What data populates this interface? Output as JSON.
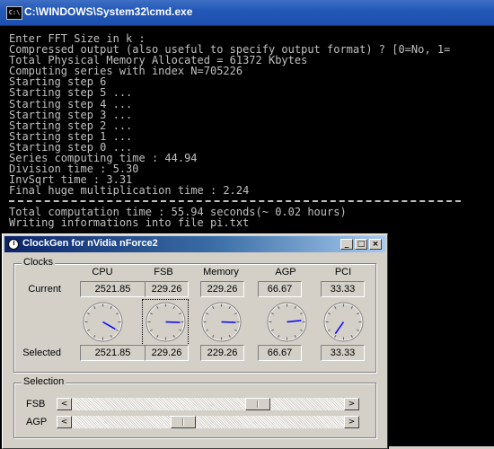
{
  "cmd": {
    "title": "C:\\WINDOWS\\System32\\cmd.exe",
    "icon": "cmd-icon",
    "lines": [
      "Enter FFT Size in k :",
      "Compressed output (also useful to specify output format) ? [0=No, 1=",
      "Total Physical Memory Allocated = 61372 Kbytes",
      "Computing series with index N=705226",
      "Starting step 6",
      "Starting step 5 ...",
      "Starting step 4 ...",
      "Starting step 3 ...",
      "Starting step 2 ...",
      "Starting step 1 ...",
      "Starting step 0 ...",
      "Series computing time : 44.94",
      "Division time : 5.30",
      "InvSqrt time : 3.31",
      "Final huge multiplication time : 2.24"
    ],
    "lines_after": [
      "Total computation time : 55.94 seconds(~ 0.02 hours)",
      "Writing informations into file pi.txt"
    ]
  },
  "clockgen": {
    "title": "ClockGen for nVidia nForce2",
    "title_buttons": {
      "minimize": "_",
      "maximize": "□",
      "close": "×"
    },
    "clocks_group_label": "Clocks",
    "columns": [
      "CPU",
      "FSB",
      "Memory",
      "AGP",
      "PCI"
    ],
    "current_label": "Current",
    "selected_label": "Selected",
    "current": [
      "2521.85",
      "229.26",
      "229.26",
      "66.67",
      "33.33"
    ],
    "selected": [
      "2521.85",
      "229.26",
      "229.26",
      "66.67",
      "33.33"
    ],
    "dial_angles_deg": [
      120,
      92,
      92,
      84,
      215
    ],
    "selection_group_label": "Selection",
    "sliders": [
      {
        "label": "FSB",
        "value_fraction": 0.7
      },
      {
        "label": "AGP",
        "value_fraction": 0.4
      }
    ],
    "arrow_left": "<",
    "arrow_right": ">"
  }
}
